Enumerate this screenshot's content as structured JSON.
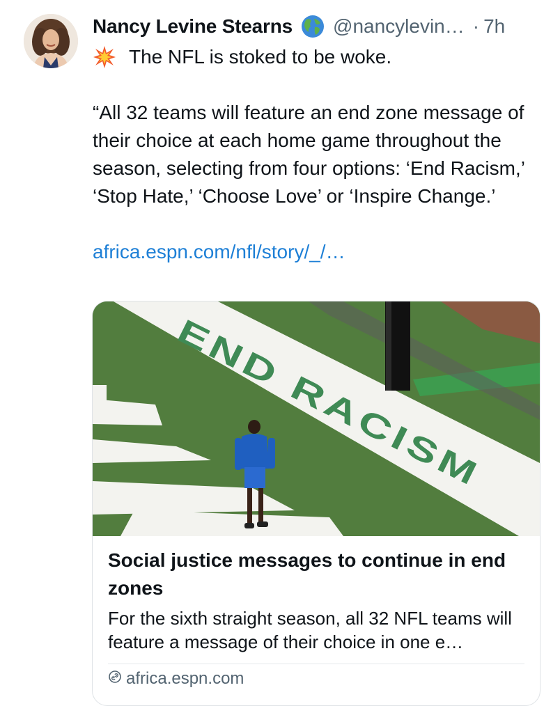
{
  "post": {
    "author": {
      "display_name": "Nancy Levine Stearns",
      "badge_icon": "globe-emoji-icon",
      "handle": "@nancylevin…",
      "separator": "·",
      "time": "7h"
    },
    "text": {
      "emoji_icon": "collision-emoji-icon",
      "line1": "The NFL is stoked to be woke.",
      "quote": "“All 32 teams will feature an end zone message of their choice at each home game throughout the season, selecting from four options: ‘End Racism,’ ‘Stop Hate,’ ‘Choose Love’ or ‘Inspire Change.’",
      "link": "africa.espn.com/nfl/story/_/…"
    },
    "card": {
      "image_text": "END RACISM",
      "title": "Social justice messages to continue in end zones",
      "description": "For the sixth straight season, all 32 NFL teams will feature a message of their choice in one e…",
      "domain": "africa.espn.com",
      "domain_icon": "link-icon"
    }
  },
  "colors": {
    "text": "#0f1419",
    "secondary": "#536471",
    "link": "#1d7fd6",
    "field_green": "#4f7a3c",
    "lettering_green": "#3f8a55"
  }
}
